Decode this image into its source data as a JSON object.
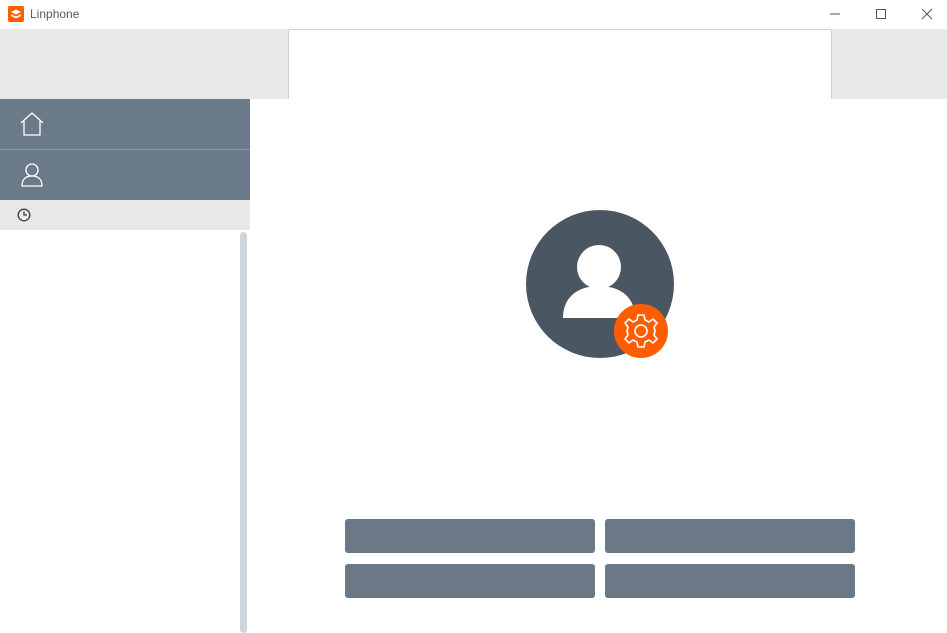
{
  "window": {
    "title": "Linphone",
    "icon": "linphone-logo-icon",
    "controls": [
      "minimize-icon",
      "maximize-icon",
      "close-icon"
    ]
  },
  "colors": {
    "brand": "#ff5e00",
    "nav_background": "#6b7a88",
    "button_background": "#6b7886",
    "avatar_background": "#4b5663",
    "topbar_background": "#e8e8e8"
  },
  "sidebar": {
    "items": [
      {
        "icon": "home-icon"
      },
      {
        "icon": "contacts-icon"
      }
    ],
    "history_icon": "clock-icon"
  },
  "main": {
    "avatar_icon": "user-avatar-icon",
    "badge_icon": "gear-icon",
    "buttons": [
      {
        "label": ""
      },
      {
        "label": ""
      },
      {
        "label": ""
      },
      {
        "label": ""
      }
    ]
  }
}
